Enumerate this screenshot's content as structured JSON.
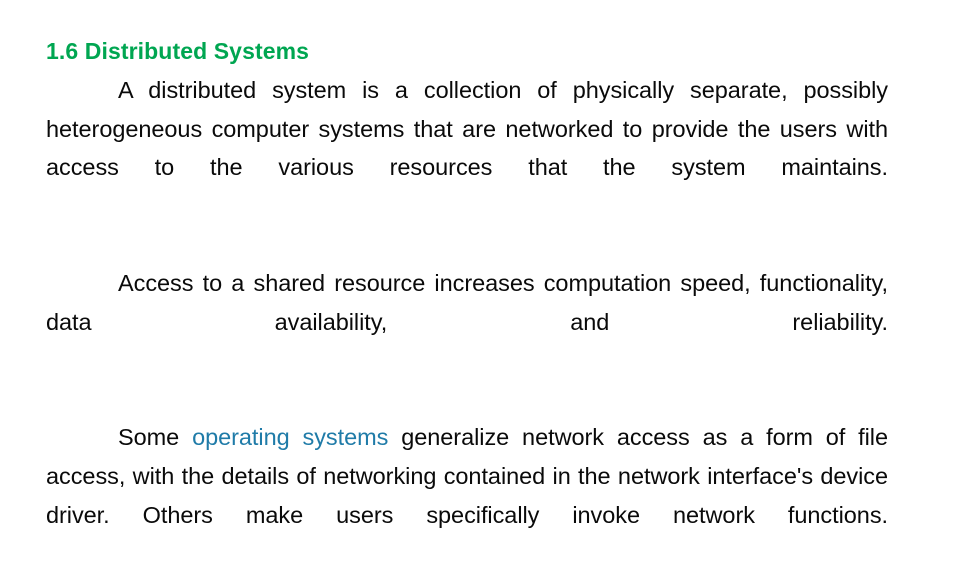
{
  "slide": {
    "title": "1.6 Distributed Systems",
    "title_color": "#00a651",
    "background_color": "#ffffff",
    "body_color": "#0a0a0a",
    "highlight_color": "#1f7ba8",
    "paragraphs": [
      {
        "id": "p1",
        "text": "A distributed system is a collection of physically separate, possibly heterogeneous computer systems that are networked to provide the users with access to the various resources that the system maintains."
      },
      {
        "id": "p2",
        "text": "Access to a shared resource increases computation speed, functionality, data availability, and reliability."
      },
      {
        "id": "p3",
        "lead": "Some ",
        "highlight": "operating systems",
        "tail": " generalize network access as a form of file access, with the details of networking contained in the network interface's device driver. Others make users specifically invoke network functions."
      }
    ]
  }
}
